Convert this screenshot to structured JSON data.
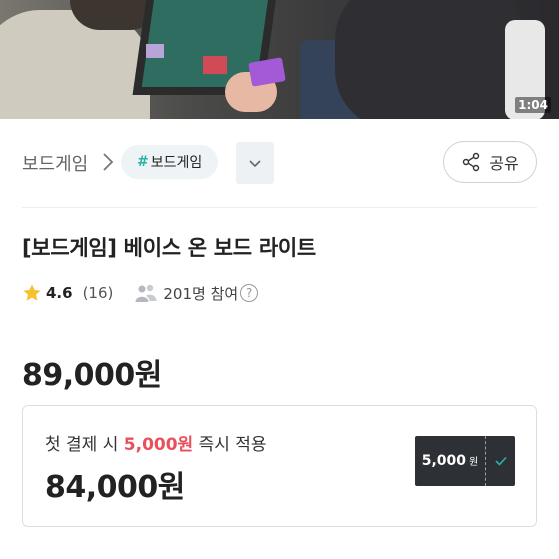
{
  "video": {
    "duration": "1:04"
  },
  "breadcrumb": {
    "root": "보드게임",
    "tag_hash": "#",
    "tag_label": "보드게임"
  },
  "share": {
    "label": "공유"
  },
  "product": {
    "title": "[보드게임] 베이스 온 보드 라이트",
    "rating": "4.6",
    "review_count": "(16)",
    "participants": "201명 참여",
    "help": "?",
    "price": "89,000원"
  },
  "coupon": {
    "prefix": "첫 결제 시 ",
    "discount": "5,000원",
    "suffix": " 즉시 적용",
    "final_price": "84,000원",
    "ticket_amount": "5,000",
    "ticket_unit": "원"
  },
  "colors": {
    "accent_teal": "#2bb3a8",
    "discount_red": "#e9505a",
    "star_yellow": "#f6c12c",
    "ticket_dark": "#2d3035"
  },
  "icons": [
    "chevron-right-icon",
    "chevron-down-icon",
    "share-icon",
    "star-icon",
    "people-icon",
    "help-icon",
    "check-icon"
  ]
}
